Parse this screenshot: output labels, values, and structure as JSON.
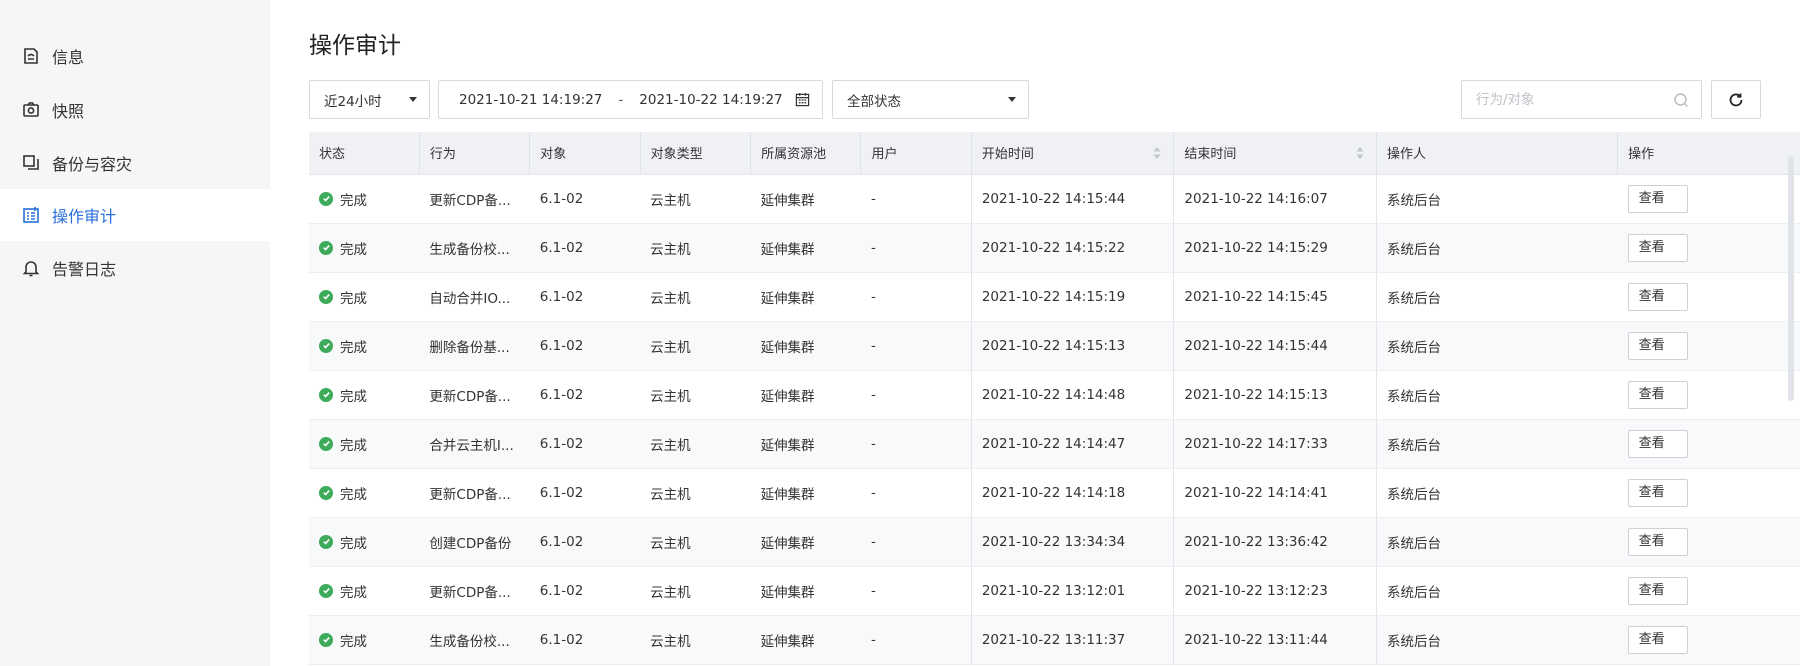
{
  "sidebar": {
    "items": [
      {
        "label": "信息",
        "icon": "info-doc-icon",
        "active": false
      },
      {
        "label": "快照",
        "icon": "camera-icon",
        "active": false
      },
      {
        "label": "备份与容灾",
        "icon": "backup-copy-icon",
        "active": false
      },
      {
        "label": "操作审计",
        "icon": "audit-list-icon",
        "active": true
      },
      {
        "label": "告警日志",
        "icon": "bell-icon",
        "active": false
      }
    ]
  },
  "main": {
    "title": "操作审计",
    "toolbar": {
      "range_value": "近24小时",
      "date_start": "2021-10-21 14:19:27",
      "date_sep": "-",
      "date_end": "2021-10-22 14:19:27",
      "status_value": "全部状态",
      "search_placeholder": "行为/对象",
      "refresh_icon": "refresh-icon"
    },
    "table": {
      "columns": [
        "状态",
        "行为",
        "对象",
        "对象类型",
        "所属资源池",
        "用户",
        "开始时间",
        "结束时间",
        "操作人",
        "操作"
      ],
      "view_label": "查看",
      "rows": [
        {
          "status": "完成",
          "action": "更新CDP备...",
          "object": "6.1-02",
          "type": "云主机",
          "pool": "延伸集群",
          "user": "-",
          "start": "2021-10-22 14:15:44",
          "end": "2021-10-22 14:16:07",
          "operator": "系统后台"
        },
        {
          "status": "完成",
          "action": "生成备份校...",
          "object": "6.1-02",
          "type": "云主机",
          "pool": "延伸集群",
          "user": "-",
          "start": "2021-10-22 14:15:22",
          "end": "2021-10-22 14:15:29",
          "operator": "系统后台"
        },
        {
          "status": "完成",
          "action": "自动合并IO...",
          "object": "6.1-02",
          "type": "云主机",
          "pool": "延伸集群",
          "user": "-",
          "start": "2021-10-22 14:15:19",
          "end": "2021-10-22 14:15:45",
          "operator": "系统后台"
        },
        {
          "status": "完成",
          "action": "删除备份基...",
          "object": "6.1-02",
          "type": "云主机",
          "pool": "延伸集群",
          "user": "-",
          "start": "2021-10-22 14:15:13",
          "end": "2021-10-22 14:15:44",
          "operator": "系统后台"
        },
        {
          "status": "完成",
          "action": "更新CDP备...",
          "object": "6.1-02",
          "type": "云主机",
          "pool": "延伸集群",
          "user": "-",
          "start": "2021-10-22 14:14:48",
          "end": "2021-10-22 14:15:13",
          "operator": "系统后台"
        },
        {
          "status": "完成",
          "action": "合并云主机I...",
          "object": "6.1-02",
          "type": "云主机",
          "pool": "延伸集群",
          "user": "-",
          "start": "2021-10-22 14:14:47",
          "end": "2021-10-22 14:17:33",
          "operator": "系统后台"
        },
        {
          "status": "完成",
          "action": "更新CDP备...",
          "object": "6.1-02",
          "type": "云主机",
          "pool": "延伸集群",
          "user": "-",
          "start": "2021-10-22 14:14:18",
          "end": "2021-10-22 14:14:41",
          "operator": "系统后台"
        },
        {
          "status": "完成",
          "action": "创建CDP备份",
          "object": "6.1-02",
          "type": "云主机",
          "pool": "延伸集群",
          "user": "-",
          "start": "2021-10-22 13:34:34",
          "end": "2021-10-22 13:36:42",
          "operator": "系统后台"
        },
        {
          "status": "完成",
          "action": "更新CDP备...",
          "object": "6.1-02",
          "type": "云主机",
          "pool": "延伸集群",
          "user": "-",
          "start": "2021-10-22 13:12:01",
          "end": "2021-10-22 13:12:23",
          "operator": "系统后台"
        },
        {
          "status": "完成",
          "action": "生成备份校...",
          "object": "6.1-02",
          "type": "云主机",
          "pool": "延伸集群",
          "user": "-",
          "start": "2021-10-22 13:11:37",
          "end": "2021-10-22 13:11:44",
          "operator": "系统后台"
        }
      ]
    }
  },
  "colors": {
    "accent": "#2a6fdb",
    "success": "#3dab5a",
    "header_bg": "#eff1f4",
    "sidebar_bg": "#f5f6f8"
  }
}
